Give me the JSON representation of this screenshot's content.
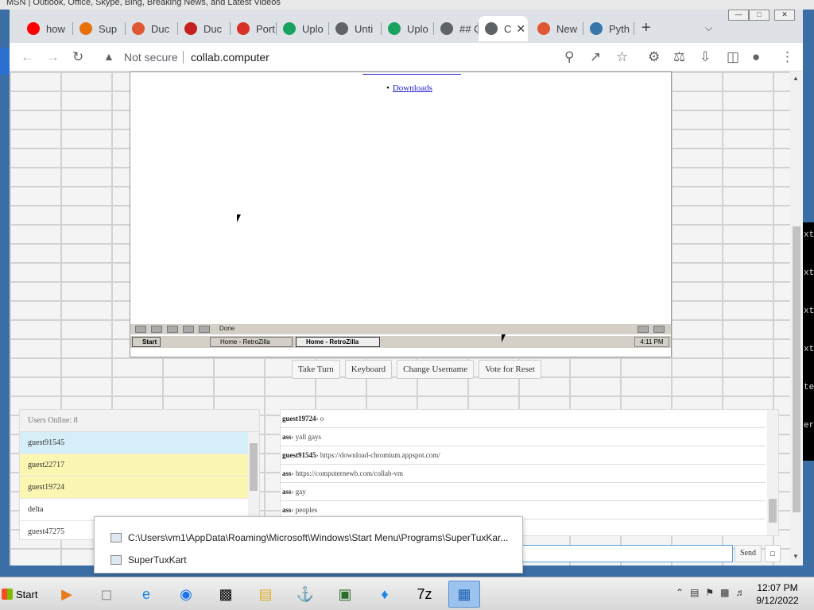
{
  "desktop": {
    "bg_title": "MSN | Outlook, Office, Skype, Bing, Breaking News, and Latest Videos",
    "right_letters": [
      "xt",
      "xt",
      "xt",
      "xt",
      "te",
      "er"
    ]
  },
  "browser": {
    "tabs": [
      {
        "label": "how",
        "icon": "youtube-icon",
        "color": "#ff0000"
      },
      {
        "label": "Sup",
        "icon": "diamond-icon",
        "color": "#e8710a"
      },
      {
        "label": "Duc",
        "icon": "duckduckgo-icon",
        "color": "#de5833"
      },
      {
        "label": "Duc",
        "icon": "chromium-icon",
        "color": "#c5221f"
      },
      {
        "label": "Port",
        "icon": "lock-icon",
        "color": "#d93025"
      },
      {
        "label": "Uplo",
        "icon": "upload-icon",
        "color": "#1aa260"
      },
      {
        "label": "Unti",
        "icon": "globe-icon",
        "color": "#5f6368"
      },
      {
        "label": "Uplo",
        "icon": "upload-icon",
        "color": "#1aa260"
      },
      {
        "label": "## C",
        "icon": "globe-icon",
        "color": "#5f6368"
      },
      {
        "label": "C",
        "icon": "globe-icon",
        "color": "#5f6368"
      },
      {
        "label": "New",
        "icon": "duckduckgo-icon",
        "color": "#de5833"
      },
      {
        "label": "Pyth",
        "icon": "python-icon",
        "color": "#3776ab"
      }
    ],
    "active_tab_index": 9,
    "security_label": "Not secure",
    "url": "collab.computer"
  },
  "vm": {
    "link_item": "Downloads",
    "status_text": "Done",
    "start_label": "Start",
    "task1": "Home - RetroZilla",
    "task2": "Home - RetroZilla",
    "clock": "4:11 PM"
  },
  "controls": {
    "take_turn": "Take Turn",
    "keyboard": "Keyboard",
    "change_username": "Change Username",
    "vote_reset": "Vote for Reset"
  },
  "users": {
    "header": "Users Online: 8",
    "list": [
      {
        "name": "guest91545",
        "bg": "#d6eef8"
      },
      {
        "name": "guest22717",
        "bg": "#fbf6b2"
      },
      {
        "name": "guest19724",
        "bg": "#fbf6b2"
      },
      {
        "name": "delta",
        "bg": "#ffffff"
      },
      {
        "name": "guest47275",
        "bg": "#ffffff"
      }
    ]
  },
  "chat": {
    "messages": [
      {
        "user": "guest19724",
        "text": "o"
      },
      {
        "user": "ass",
        "text": "yall gays"
      },
      {
        "user": "guest91545",
        "text": "https://download-chromium.appspot.com/"
      },
      {
        "user": "ass",
        "text": "https://computernewb.com/collab-vm"
      },
      {
        "user": "ass",
        "text": "gay"
      },
      {
        "user": "ass",
        "text": "peoples"
      }
    ],
    "send_label": "Send"
  },
  "autocomplete": {
    "item1": "C:\\Users\\vm1\\AppData\\Roaming\\Microsoft\\Windows\\Start Menu\\Programs\\SuperTuxKar...",
    "item2": "SuperTuxKart"
  },
  "taskbar": {
    "start_label": "Start",
    "time": "12:07 PM",
    "date": "9/12/2022"
  }
}
